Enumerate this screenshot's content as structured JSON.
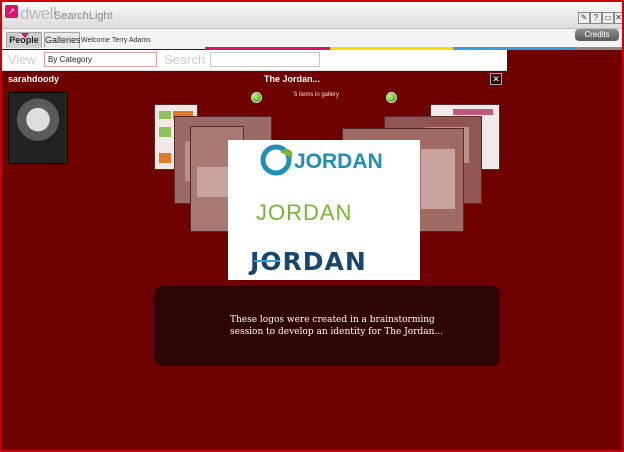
{
  "app": {
    "brand": "dwell",
    "name": "SearchLight",
    "window_buttons": [
      "✎",
      "?",
      "▭",
      "✕"
    ]
  },
  "nav": {
    "tabs": [
      {
        "label": "People",
        "active": true
      },
      {
        "label": "Galleries",
        "active": false
      }
    ],
    "welcome": "Welcome Terry Adams",
    "credits": "Credits"
  },
  "colors": {
    "frame_border": "#cc0000",
    "content_bg": "#6e0000",
    "stripes": [
      "#e0106a",
      "#f1e000",
      "#3aa0e0",
      "#8a8a8a"
    ],
    "jordan_green": "#79b535",
    "jordan_blue": "#1f8fb4",
    "jordan_navy": "#17466e"
  },
  "filters": {
    "view_label": "View",
    "category_value": "By Category",
    "search_label": "Search",
    "search_value": ""
  },
  "profile": {
    "username": "sarahdoody"
  },
  "gallery": {
    "title": "The Jordan...",
    "items_count": "5 items in gallery",
    "logos": [
      "JORDAN",
      "JORDAN",
      "JORDAN"
    ],
    "caption_line1": "These logos were created in a brainstorming",
    "caption_line2": "session to develop an identity for The Jordan..."
  }
}
